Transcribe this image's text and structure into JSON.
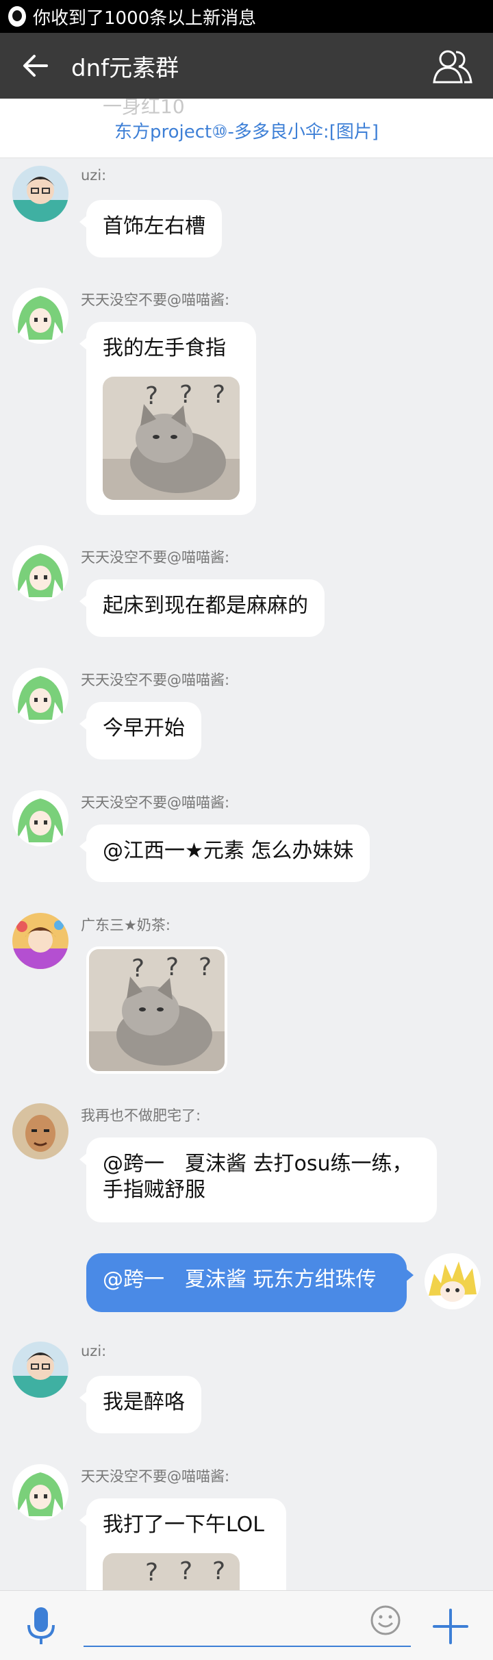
{
  "statusbar": {
    "notification": "你收到了1000条以上新消息"
  },
  "header": {
    "title": "dnf元素群"
  },
  "banner": {
    "faded_text": "一身红10",
    "link_text": "东方project⑩-多多良小伞:[图片]"
  },
  "messages": [
    {
      "sender": "uzi:",
      "text": "首饰左右槽"
    },
    {
      "sender": "天天没空不要@喵喵酱:",
      "text": "我的左手食指",
      "image": "cat-image"
    },
    {
      "sender": "天天没空不要@喵喵酱:",
      "text": "起床到现在都是麻麻的"
    },
    {
      "sender": "天天没空不要@喵喵酱:",
      "text": "今早开始"
    },
    {
      "sender": "天天没空不要@喵喵酱:",
      "text": "@江西一★元素 怎么办妹妹"
    },
    {
      "sender": "广东三★奶茶:",
      "image": "cat-image"
    },
    {
      "sender": "我再也不做肥宅了:",
      "text": "@跨一　夏沫酱 去打osu练一练，手指贼舒服"
    },
    {
      "sender": "",
      "text": "@跨一　夏沫酱 玩东方绀珠传",
      "mine": true
    },
    {
      "sender": "uzi:",
      "text": "我是醉咯"
    },
    {
      "sender": "天天没空不要@喵喵酱:",
      "text": "我打了一下午LOL",
      "image": "cat-image"
    }
  ],
  "input": {
    "placeholder": ""
  },
  "colors": {
    "accent": "#3d7fd6",
    "mine_bubble": "#4a8ae6",
    "titlebar": "#3a3a3a"
  }
}
